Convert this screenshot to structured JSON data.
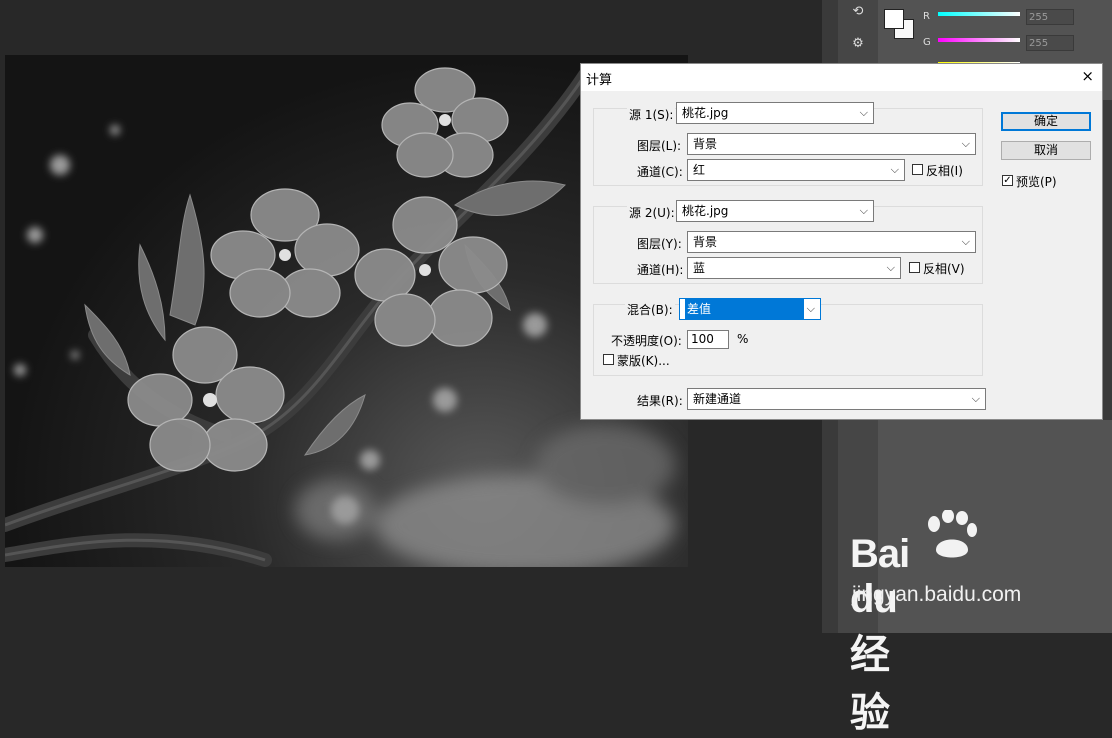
{
  "dialog": {
    "title": "计算",
    "source1": {
      "label": "源 1(S):",
      "file": "桃花.jpg",
      "layer_label": "图层(L):",
      "layer": "背景",
      "channel_label": "通道(C):",
      "channel": "红",
      "invert_label": "反相(I)",
      "invert_checked": false
    },
    "source2": {
      "label": "源 2(U):",
      "file": "桃花.jpg",
      "layer_label": "图层(Y):",
      "layer": "背景",
      "channel_label": "通道(H):",
      "channel": "蓝",
      "invert_label": "反相(V)",
      "invert_checked": false
    },
    "blend": {
      "label": "混合(B):",
      "mode": "差值",
      "opacity_label": "不透明度(O):",
      "opacity": "100",
      "opacity_unit": "%",
      "mask_label": "蒙版(K)...",
      "mask_checked": false
    },
    "result": {
      "label": "结果(R):",
      "value": "新建通道"
    },
    "buttons": {
      "ok": "确定",
      "cancel": "取消",
      "preview_label": "预览(P)",
      "preview_checked": true
    },
    "close_glyph": "×"
  },
  "color_panel": {
    "r_label": "R",
    "g_label": "G",
    "r_value": "255",
    "g_value": "255"
  },
  "watermark": {
    "logo_text": "Bai du 经验",
    "url": "jingyan.baidu.com"
  },
  "colors": {
    "accent": "#0078d7",
    "dialog_bg": "#f0f0f0",
    "app_bg": "#282828"
  }
}
